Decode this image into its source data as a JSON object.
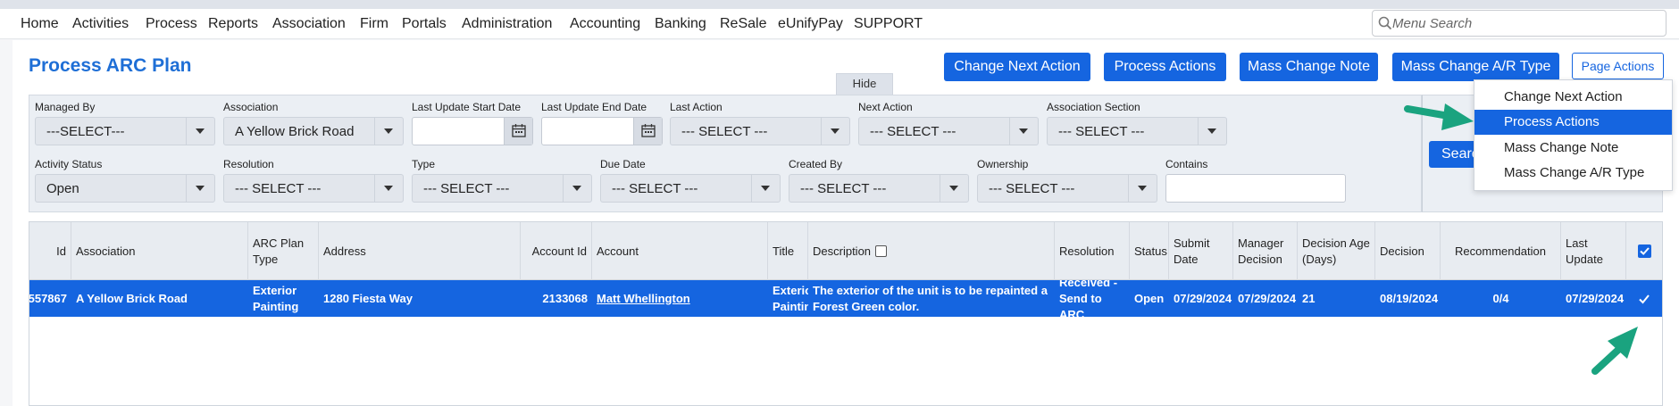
{
  "nav": {
    "items": [
      "Home",
      "Activities",
      "Process",
      "Reports",
      "Association",
      "Firm",
      "Portals",
      "Administration",
      "Accounting",
      "Banking",
      "ReSale",
      "eUnifyPay",
      "SUPPORT"
    ],
    "search_placeholder": "Menu Search"
  },
  "page": {
    "title": "Process ARC Plan",
    "buttons": {
      "change_next_action": "Change Next Action",
      "process_actions": "Process Actions",
      "mass_change_note": "Mass Change Note",
      "mass_change_ar_type": "Mass Change A/R Type",
      "page_actions": "Page Actions"
    },
    "hide_label": "Hide",
    "search_label": "Search"
  },
  "page_actions_menu": {
    "options": [
      "Change Next Action",
      "Process Actions",
      "Mass Change Note",
      "Mass Change A/R Type"
    ],
    "highlighted": "Process Actions"
  },
  "filters": {
    "managed_by": {
      "label": "Managed By",
      "value": "---SELECT---"
    },
    "association": {
      "label": "Association",
      "value": "A Yellow Brick Road"
    },
    "last_update_start": {
      "label": "Last Update Start Date",
      "value": ""
    },
    "last_update_end": {
      "label": "Last Update End Date",
      "value": ""
    },
    "last_action": {
      "label": "Last Action",
      "value": "--- SELECT ---"
    },
    "next_action": {
      "label": "Next Action",
      "value": "--- SELECT ---"
    },
    "association_section": {
      "label": "Association Section",
      "value": "--- SELECT ---"
    },
    "activity_status": {
      "label": "Activity Status",
      "value": "Open"
    },
    "resolution": {
      "label": "Resolution",
      "value": "--- SELECT ---"
    },
    "type": {
      "label": "Type",
      "value": "--- SELECT ---"
    },
    "due_date": {
      "label": "Due Date",
      "value": "--- SELECT ---"
    },
    "created_by": {
      "label": "Created By",
      "value": "--- SELECT ---"
    },
    "ownership": {
      "label": "Ownership",
      "value": "--- SELECT ---"
    },
    "contains": {
      "label": "Contains",
      "value": ""
    }
  },
  "grid": {
    "columns": {
      "id": "Id",
      "association": "Association",
      "arc_plan_type": "ARC Plan Type",
      "address": "Address",
      "account_id": "Account Id",
      "account": "Account",
      "title": "Title",
      "description": "Description",
      "resolution": "Resolution",
      "status": "Status",
      "submit_date": "Submit Date",
      "manager_decision": "Manager Decision",
      "decision_age": "Decision Age (Days)",
      "decision": "Decision",
      "recommendation": "Recommendation",
      "last_update": "Last Update"
    },
    "rows": [
      {
        "id": "557867",
        "association": "A Yellow Brick Road",
        "arc_plan_type": "Exterior Painting",
        "address": "1280 Fiesta Way",
        "account_id": "2133068",
        "account": "Matt Whellington",
        "title": "Exterior Painting",
        "description": "The exterior of the unit is to be repainted a Forest Green color.",
        "resolution": "Received - Send to ARC",
        "status": "Open",
        "submit_date": "07/29/2024",
        "manager_decision": "07/29/2024",
        "decision_age": "21",
        "decision": "08/19/2024",
        "recommendation": "0/4",
        "last_update": "07/29/2024",
        "checked": true
      }
    ]
  },
  "colors": {
    "accent": "#1565e0",
    "arrow": "#1aa37f"
  }
}
